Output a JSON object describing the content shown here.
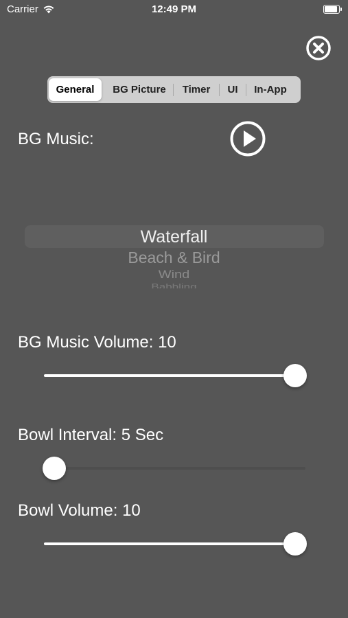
{
  "status_bar": {
    "carrier": "Carrier",
    "time": "12:49 PM",
    "battery_level": 1.0
  },
  "icons": {
    "wifi": "wifi-icon",
    "battery": "battery-icon",
    "close": "close-circle-icon",
    "play": "play-circle-icon"
  },
  "tabs": [
    {
      "label": "General",
      "selected": true
    },
    {
      "label": "BG Picture",
      "selected": false
    },
    {
      "label": "Timer",
      "selected": false
    },
    {
      "label": "UI",
      "selected": false
    },
    {
      "label": "In-App",
      "selected": false
    }
  ],
  "bg_music": {
    "label": "BG Music:",
    "options": [
      "Waterfall",
      "Beach & Bird",
      "Wind",
      "Babbling"
    ],
    "selected": "Waterfall"
  },
  "sliders": [
    {
      "label": "BG Music Volume: 10",
      "value": 1.0
    },
    {
      "label": "Bowl Interval: 5 Sec",
      "value": 0.0
    },
    {
      "label": "Bowl Volume: 10",
      "value": 1.0
    }
  ],
  "colors": {
    "background": "#565656",
    "accent": "#ffffff",
    "segment_bg": "#cfcfcf"
  }
}
